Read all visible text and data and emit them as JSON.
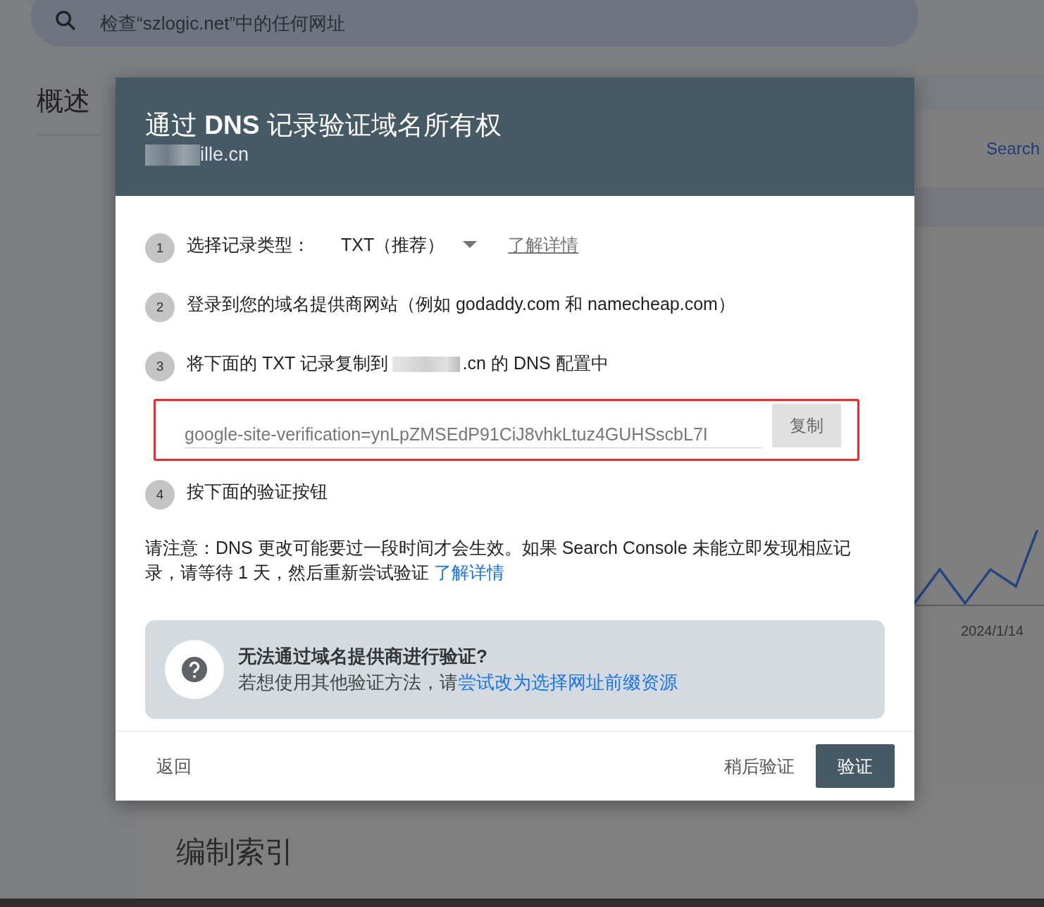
{
  "search": {
    "placeholder": "检查“szlogic.net”中的任何网址"
  },
  "page": {
    "heading": "概述",
    "search_link": "Search",
    "chart_axis_label": "2024/1/14",
    "section_heading": "编制索引"
  },
  "dialog": {
    "title": "通过 **DNS** 记录验证域名所有权",
    "domain": "ille.cn",
    "steps": [
      {
        "number": "1",
        "kind": "select",
        "label": "选择记录类型：",
        "value": "TXT（推荐）",
        "link": "了解详情"
      },
      {
        "number": "2",
        "kind": "text",
        "text": "登录到您的域名提供商网站（例如 godaddy.com 和 namecheap.com）"
      },
      {
        "number": "3",
        "kind": "copy",
        "text_before": "将下面的 TXT 记录复制到",
        "text_after": ".cn 的 DNS 配置中",
        "record": "google-site-verification=ynLpZMSEdP91CiJ8vhkLtuz4GUHSscbL7I",
        "copy_button": "复制"
      },
      {
        "number": "4",
        "kind": "text",
        "text": "按下面的验证按钮"
      }
    ],
    "note": "请注意：DNS 更改可能要过一段时间才会生效。如果 Search Console 未能立即发现相应记录，请等待 1 天，然后重新尝试验证",
    "note_link": "了解详情",
    "help": {
      "title": "无法通过域名提供商进行验证?",
      "text": "若想使用其他验证方法，请",
      "link": "尝试改为选择网址前缀资源"
    },
    "buttons": {
      "back": "返回",
      "later": "稍后验证",
      "verify": "验证"
    }
  }
}
